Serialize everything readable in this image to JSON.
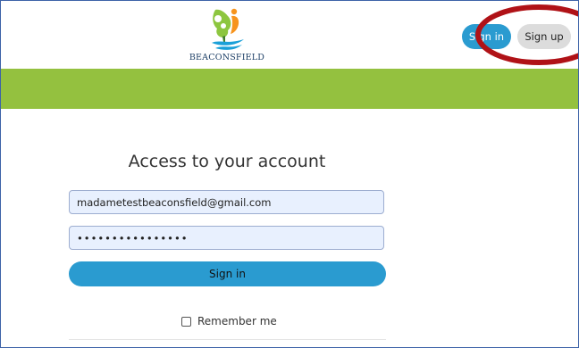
{
  "header": {
    "logo_text": "BEACONSFIELD",
    "signin_label": "Sign in",
    "signup_label": "Sign up"
  },
  "login": {
    "title": "Access to your account",
    "email_value": "madametestbeaconsfield@gmail.com",
    "password_value": "••••••••••••••••",
    "signin_label": "Sign in",
    "remember_label": "Remember me"
  },
  "colors": {
    "accent_blue": "#2a9bd0",
    "green_band": "#94c13f",
    "annotation_red": "#b01217",
    "input_bg": "#e8f0fe"
  },
  "annotation": {
    "shape": "red-ellipse",
    "target": "signup-button"
  }
}
